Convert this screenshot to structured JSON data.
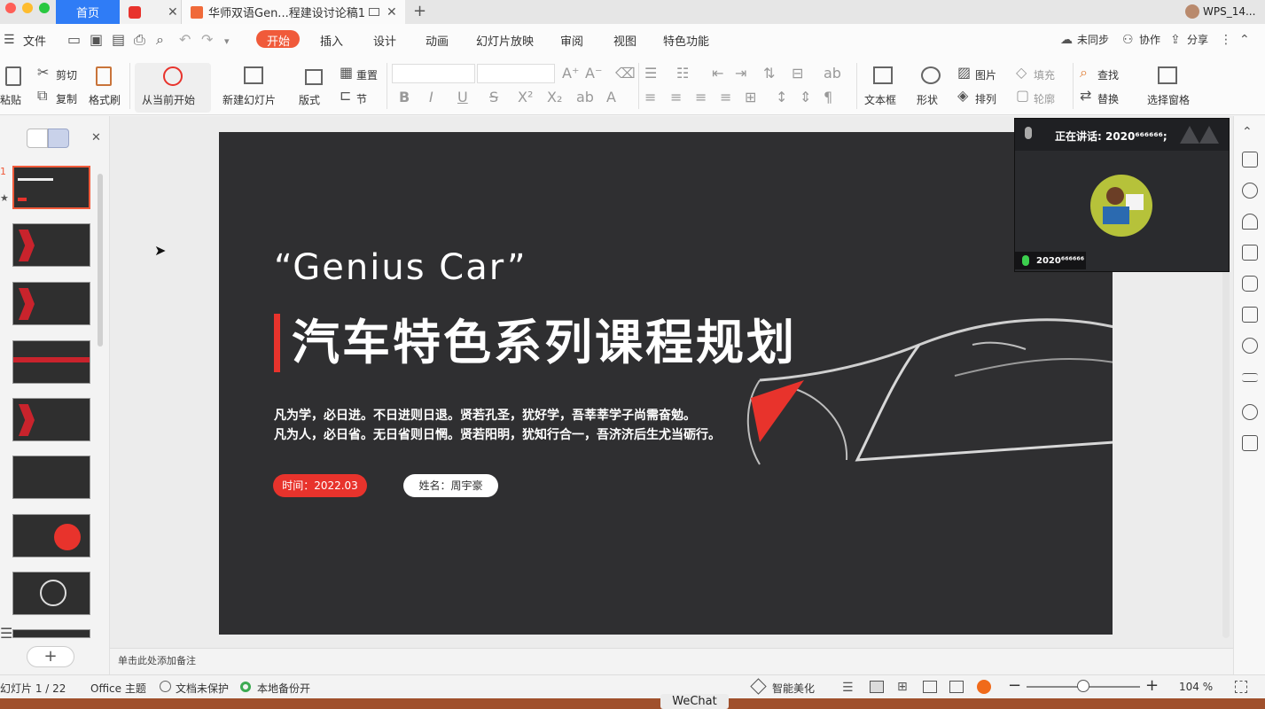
{
  "titlebar": {
    "tabs": [
      {
        "label": "首页"
      },
      {
        "label": "华师双语Gen...程建设讨论稿1"
      }
    ],
    "account": "WPS_14..."
  },
  "ribbon": {
    "tabs": [
      "文件",
      "开始",
      "插入",
      "设计",
      "动画",
      "幻灯片放映",
      "审阅",
      "视图",
      "特色功能"
    ],
    "active_tab": "开始",
    "right": {
      "sync": "未同步",
      "collab": "协作",
      "share": "分享"
    }
  },
  "toolbar": {
    "paste": "粘贴",
    "cut": "剪切",
    "copy": "复制",
    "format_painter": "格式刷",
    "from_current": "从当前开始",
    "new_slide": "新建幻灯片",
    "layout": "版式",
    "reset": "重置",
    "section": "节",
    "textbox": "文本框",
    "shape": "形状",
    "picture": "图片",
    "arrange": "排列",
    "fill": "填充",
    "outline": "轮廓",
    "find": "查找",
    "replace": "替换",
    "select_pane": "选择窗格"
  },
  "slide": {
    "title_en": "“Genius Car”",
    "title_cn": "汽车特色系列课程规划",
    "line1": "凡为学，必日进。不日进则日退。贤若孔圣，犹好学，吾莘莘学子尚需奋勉。",
    "line2": "凡为人，必日省。无日省则日惘。贤若阳明，犹知行合一，吾济济后生尤当砺行。",
    "date_pill": "时间：2022.03",
    "name_pill": "姓名：周宇豪"
  },
  "meeting": {
    "speaking": "正在讲话: 2020⁶⁶⁶⁶⁶⁶;",
    "user": "2020⁶⁶⁶⁶⁶⁶"
  },
  "left_panel": {
    "first_index": "1",
    "add": "+"
  },
  "notes": {
    "placeholder": "单击此处添加备注"
  },
  "status": {
    "slide_count": "幻灯片 1 / 22",
    "theme": "Office 主题",
    "protect": "文档未保护",
    "backup": "本地备份开",
    "beautify": "智能美化",
    "zoom": "104 %"
  },
  "dock": {
    "wechat": "WeChat"
  },
  "colors": {
    "accent": "#f05a3a",
    "slide_bg": "#2f2f31",
    "red": "#e8332c"
  }
}
